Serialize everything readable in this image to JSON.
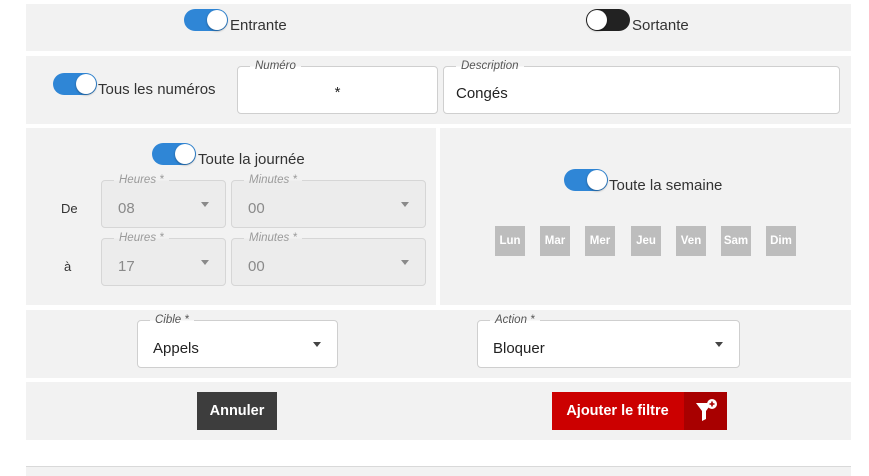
{
  "direction": {
    "incoming": {
      "label": "Entrante",
      "on": true
    },
    "outgoing": {
      "label": "Sortante",
      "on": false
    }
  },
  "numbers": {
    "all_numbers": {
      "label": "Tous les numéros",
      "on": true
    },
    "number_field": {
      "label": "Numéro",
      "value": "*"
    },
    "description_field": {
      "label": "Description",
      "value": "Congés"
    }
  },
  "schedule": {
    "all_day": {
      "label": "Toute la journée",
      "on": true
    },
    "from_label": "De",
    "to_label": "à",
    "from": {
      "hours_label": "Heures *",
      "hours": "08",
      "minutes_label": "Minutes *",
      "minutes": "00"
    },
    "to": {
      "hours_label": "Heures *",
      "hours": "17",
      "minutes_label": "Minutes *",
      "minutes": "00"
    }
  },
  "week": {
    "all_week": {
      "label": "Toute la semaine",
      "on": true
    },
    "days": [
      "Lun",
      "Mar",
      "Mer",
      "Jeu",
      "Ven",
      "Sam",
      "Dim"
    ]
  },
  "rule": {
    "target": {
      "label": "Cible *",
      "value": "Appels"
    },
    "action": {
      "label": "Action *",
      "value": "Bloquer"
    }
  },
  "buttons": {
    "cancel": "Annuler",
    "add_filter": "Ajouter le filtre",
    "add_filter_icon": "filter-add-icon"
  },
  "colors": {
    "toggle_on": "#2f86d6",
    "toggle_off": "#222222",
    "cancel_bg": "#3d3d3d",
    "add_filter_bg": "#cc0000",
    "day_bg": "#bdbdbd"
  }
}
